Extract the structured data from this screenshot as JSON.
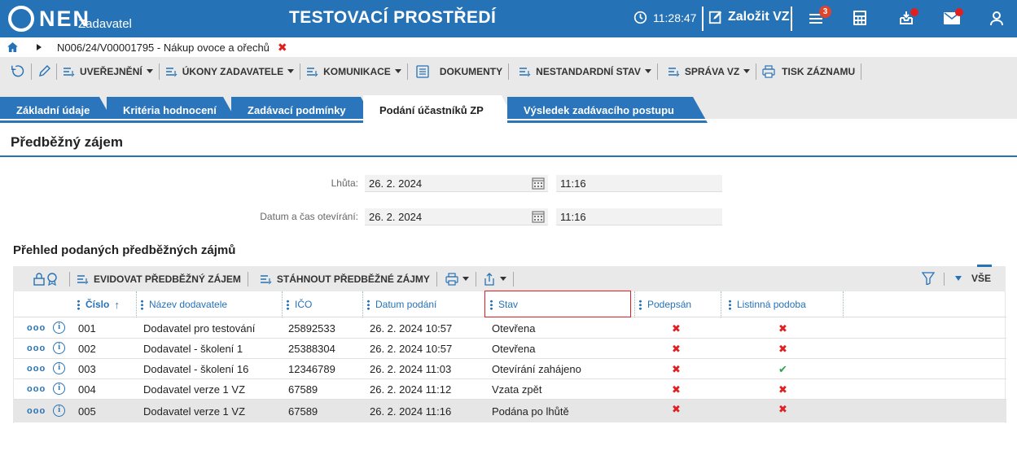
{
  "topbar": {
    "logo_text": "NEN",
    "logo_sub": "Zadavatel",
    "env_title": "TESTOVACÍ PROSTŘEDÍ",
    "time": "11:28:47",
    "create_label": "Založit VZ",
    "badge_count": "3",
    "brand_color": "#2672b6"
  },
  "breadcrumb": {
    "text": "N006/24/V00001795 - Nákup ovoce a ořechů",
    "close": "✖"
  },
  "menubar": {
    "items": [
      {
        "label": "UVEŘEJNĚNÍ"
      },
      {
        "label": "ÚKONY ZADAVATELE"
      },
      {
        "label": "KOMUNIKACE"
      },
      {
        "label": "DOKUMENTY"
      },
      {
        "label": "NESTANDARDNÍ STAV"
      },
      {
        "label": "SPRÁVA VZ"
      },
      {
        "label": "TISK ZÁZNAMU"
      }
    ]
  },
  "tabs": [
    {
      "label": "Základní údaje",
      "active": false
    },
    {
      "label": "Kritéria hodnocení",
      "active": false
    },
    {
      "label": "Zadávací podmínky",
      "active": false
    },
    {
      "label": "Podání účastníků ZP",
      "active": true
    },
    {
      "label": "Výsledek zadávacího postupu",
      "active": false
    }
  ],
  "section": {
    "title": "Předběžný zájem",
    "lhuta_label": "Lhůta:",
    "lhuta_date": "26. 2. 2024",
    "lhuta_time": "11:16",
    "open_label": "Datum a čas otevírání:",
    "open_date": "26. 2. 2024",
    "open_time": "11:16"
  },
  "grid": {
    "title": "Přehled podaných předběžných zájmů",
    "toolbar": {
      "evidovat": "EVIDOVAT PŘEDBĚŽNÝ ZÁJEM",
      "stahnout": "STÁHNOUT PŘEDBĚŽNÉ ZÁJMY",
      "all": "VŠE"
    },
    "columns": [
      "Číslo",
      "Název dodavatele",
      "IČO",
      "Datum podání",
      "Stav",
      "Podepsán",
      "Listinná podoba"
    ],
    "sort_indicator": "↑",
    "rows": [
      {
        "cislo": "001",
        "nazev": "Dodavatel pro testování",
        "ico": "25892533",
        "datum": "26. 2. 2024 10:57",
        "stav": "Otevřena",
        "podepsan": "✖",
        "listinna": "✖"
      },
      {
        "cislo": "002",
        "nazev": "Dodavatel - školení 1",
        "ico": "25388304",
        "datum": "26. 2. 2024 10:57",
        "stav": "Otevřena",
        "podepsan": "✖",
        "listinna": "✖"
      },
      {
        "cislo": "003",
        "nazev": "Dodavatel - školení 16",
        "ico": "12346789",
        "datum": "26. 2. 2024 11:03",
        "stav": "Otevírání zahájeno",
        "podepsan": "✖",
        "listinna": "✔"
      },
      {
        "cislo": "004",
        "nazev": "Dodavatel verze 1 VZ",
        "ico": "67589",
        "datum": "26. 2. 2024 11:12",
        "stav": "Vzata zpět",
        "podepsan": "✖",
        "listinna": "✖"
      },
      {
        "cislo": "005",
        "nazev": "Dodavatel verze 1 VZ",
        "ico": "67589",
        "datum": "26. 2. 2024 11:16",
        "stav": "Podána po lhůtě",
        "podepsan": "✖",
        "listinna": "✖"
      }
    ],
    "row_more": "ooo",
    "row_info": "i"
  }
}
